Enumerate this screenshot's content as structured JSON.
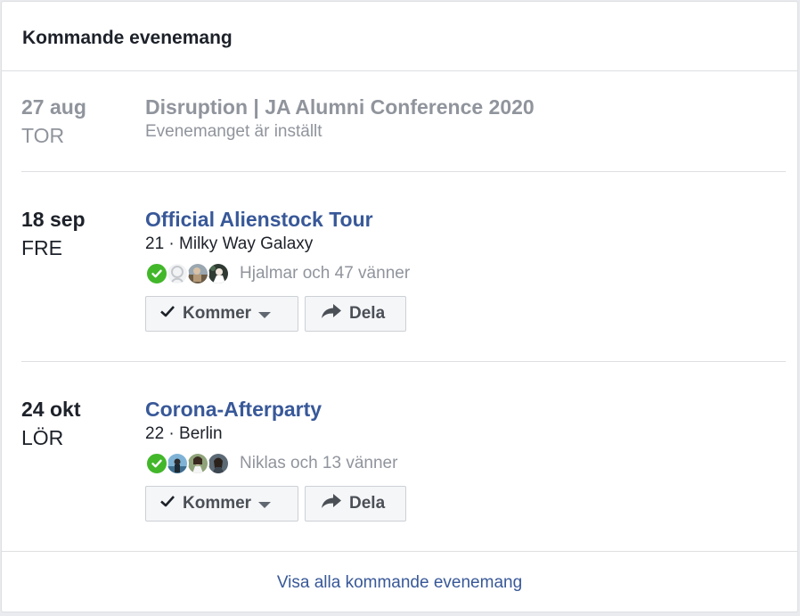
{
  "widget": {
    "title": "Kommande evenemang",
    "footer_link": "Visa alla kommande evenemang"
  },
  "events": [
    {
      "day": "27 aug",
      "weekday": "TOR",
      "title": "Disruption | JA Alumni Conference 2020",
      "subtitle": "Evenemanget är inställt",
      "cancelled": true
    },
    {
      "day": "18 sep",
      "weekday": "FRE",
      "title": "Official Alienstock Tour",
      "subtitle": "21 · Milky Way Galaxy",
      "friends_text": "Hjalmar och 47 vänner",
      "going_label": "Kommer",
      "share_label": "Dela",
      "cancelled": false
    },
    {
      "day": "24 okt",
      "weekday": "LÖR",
      "title": "Corona-Afterparty",
      "subtitle": "22 · Berlin",
      "friends_text": "Niklas och 13 vänner",
      "going_label": "Kommer",
      "share_label": "Dela",
      "cancelled": false
    }
  ],
  "colors": {
    "link": "#385898",
    "muted": "#90949c",
    "text": "#1d2129",
    "going_check": "#42b72a",
    "divider": "#dddfe2"
  },
  "icons": {
    "going_badge": "check-circle-icon",
    "going_button": "checkmark-icon",
    "dropdown": "caret-down-icon",
    "share": "share-arrow-icon"
  }
}
